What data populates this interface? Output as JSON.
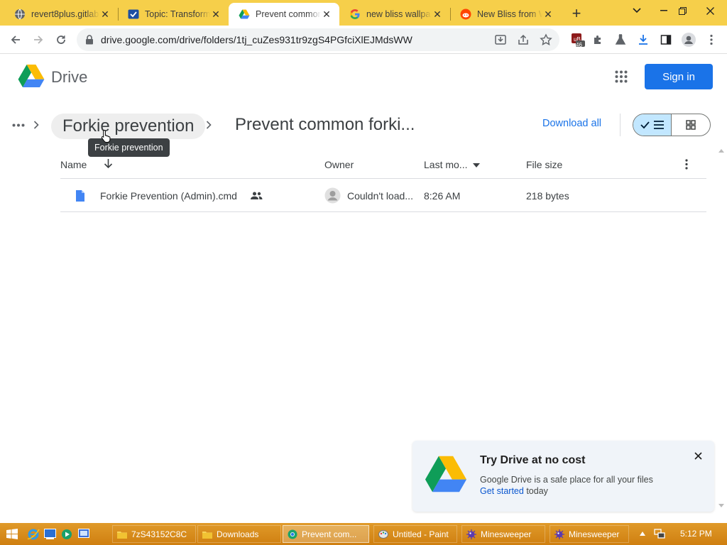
{
  "browser": {
    "tabs": [
      {
        "title": "revert8plus.gitlab",
        "icon": "globe-icon"
      },
      {
        "title": "Topic: Transform",
        "icon": "forum-icon"
      },
      {
        "title": "Prevent common",
        "icon": "drive-icon",
        "active": true
      },
      {
        "title": "new bliss wallpa",
        "icon": "google-icon"
      },
      {
        "title": "New Bliss from W",
        "icon": "reddit-icon"
      }
    ],
    "url": "drive.google.com/drive/folders/1tj_cuZes931tr9zgS4PGfciXlEJMdsWW",
    "extension_badge": "46"
  },
  "header": {
    "app_name": "Drive",
    "sign_in": "Sign in"
  },
  "breadcrumb": {
    "parent": "Forkie prevention",
    "current": "Prevent common forki...",
    "tooltip": "Forkie prevention"
  },
  "actions": {
    "download_all": "Download all"
  },
  "table": {
    "columns": {
      "name": "Name",
      "owner": "Owner",
      "modified": "Last mo...",
      "size": "File size"
    },
    "rows": [
      {
        "name": "Forkie Prevention (Admin).cmd",
        "owner": "Couldn't load...",
        "modified": "8:26 AM",
        "size": "218 bytes"
      }
    ]
  },
  "promo": {
    "title": "Try Drive at no cost",
    "line1": "Google Drive is a safe place for all your files",
    "link": "Get started",
    "after_link": "today"
  },
  "taskbar": {
    "items": [
      {
        "label": "7zS43152C8C",
        "icon": "folder-icon"
      },
      {
        "label": "Downloads",
        "icon": "folder-icon"
      },
      {
        "label": "Prevent com...",
        "icon": "chrome-icon",
        "active": true
      },
      {
        "label": "Untitled - Paint",
        "icon": "paint-icon"
      },
      {
        "label": "Minesweeper",
        "icon": "minesweeper-icon"
      },
      {
        "label": "Minesweeper",
        "icon": "minesweeper-icon"
      }
    ],
    "clock": "5:12 PM"
  },
  "colors": {
    "accent": "#1a73e8",
    "taskbar": "#d78a18",
    "tabstrip": "#f6cf4a"
  }
}
